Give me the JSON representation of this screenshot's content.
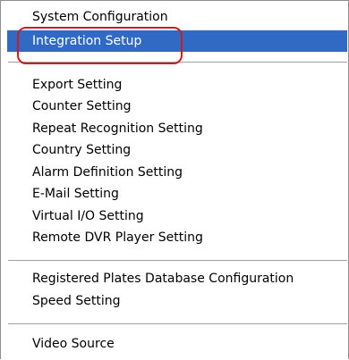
{
  "menu": {
    "groups": [
      {
        "items": [
          {
            "label": "System Configuration"
          },
          {
            "label": "Integration Setup",
            "selected": true
          }
        ]
      },
      {
        "items": [
          {
            "label": "Export Setting"
          },
          {
            "label": "Counter Setting"
          },
          {
            "label": "Repeat Recognition Setting"
          },
          {
            "label": "Country Setting"
          },
          {
            "label": "Alarm Definition Setting"
          },
          {
            "label": "E-Mail Setting"
          },
          {
            "label": "Virtual I/O Setting"
          },
          {
            "label": "Remote DVR Player Setting"
          }
        ]
      },
      {
        "items": [
          {
            "label": "Registered Plates Database Configuration"
          },
          {
            "label": "Speed Setting"
          }
        ]
      },
      {
        "items": [
          {
            "label": "Video Source"
          }
        ]
      }
    ]
  },
  "colors": {
    "selection_background": "#316ac5",
    "selection_text": "#ffffff",
    "annotation_ring": "#d11a1a",
    "separator": "#a0a0a0"
  }
}
